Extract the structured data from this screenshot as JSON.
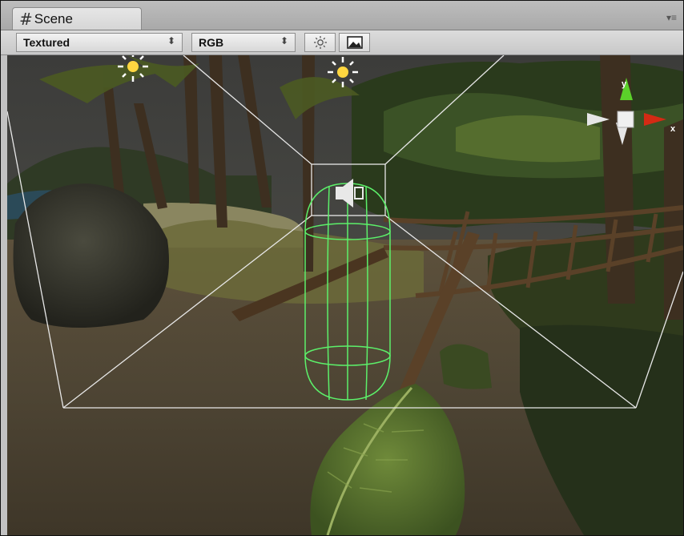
{
  "tab": {
    "hash_glyph": "#",
    "title": "Scene",
    "menu_glyph": "▾≡"
  },
  "toolbar": {
    "render_mode": "Textured",
    "color_mode": "RGB",
    "dropdown_arrow": "⬍",
    "lighting_toggle_icon": "sun-icon",
    "fx_toggle_icon": "image-icon"
  },
  "gizmo": {
    "x_label": "x",
    "y_label": "y",
    "x_color": "#d42a14",
    "y_color": "#5bd12a"
  },
  "colors": {
    "frustum": "#e8e8e8",
    "collider": "#5cf06a",
    "sun": "#ffd640"
  }
}
